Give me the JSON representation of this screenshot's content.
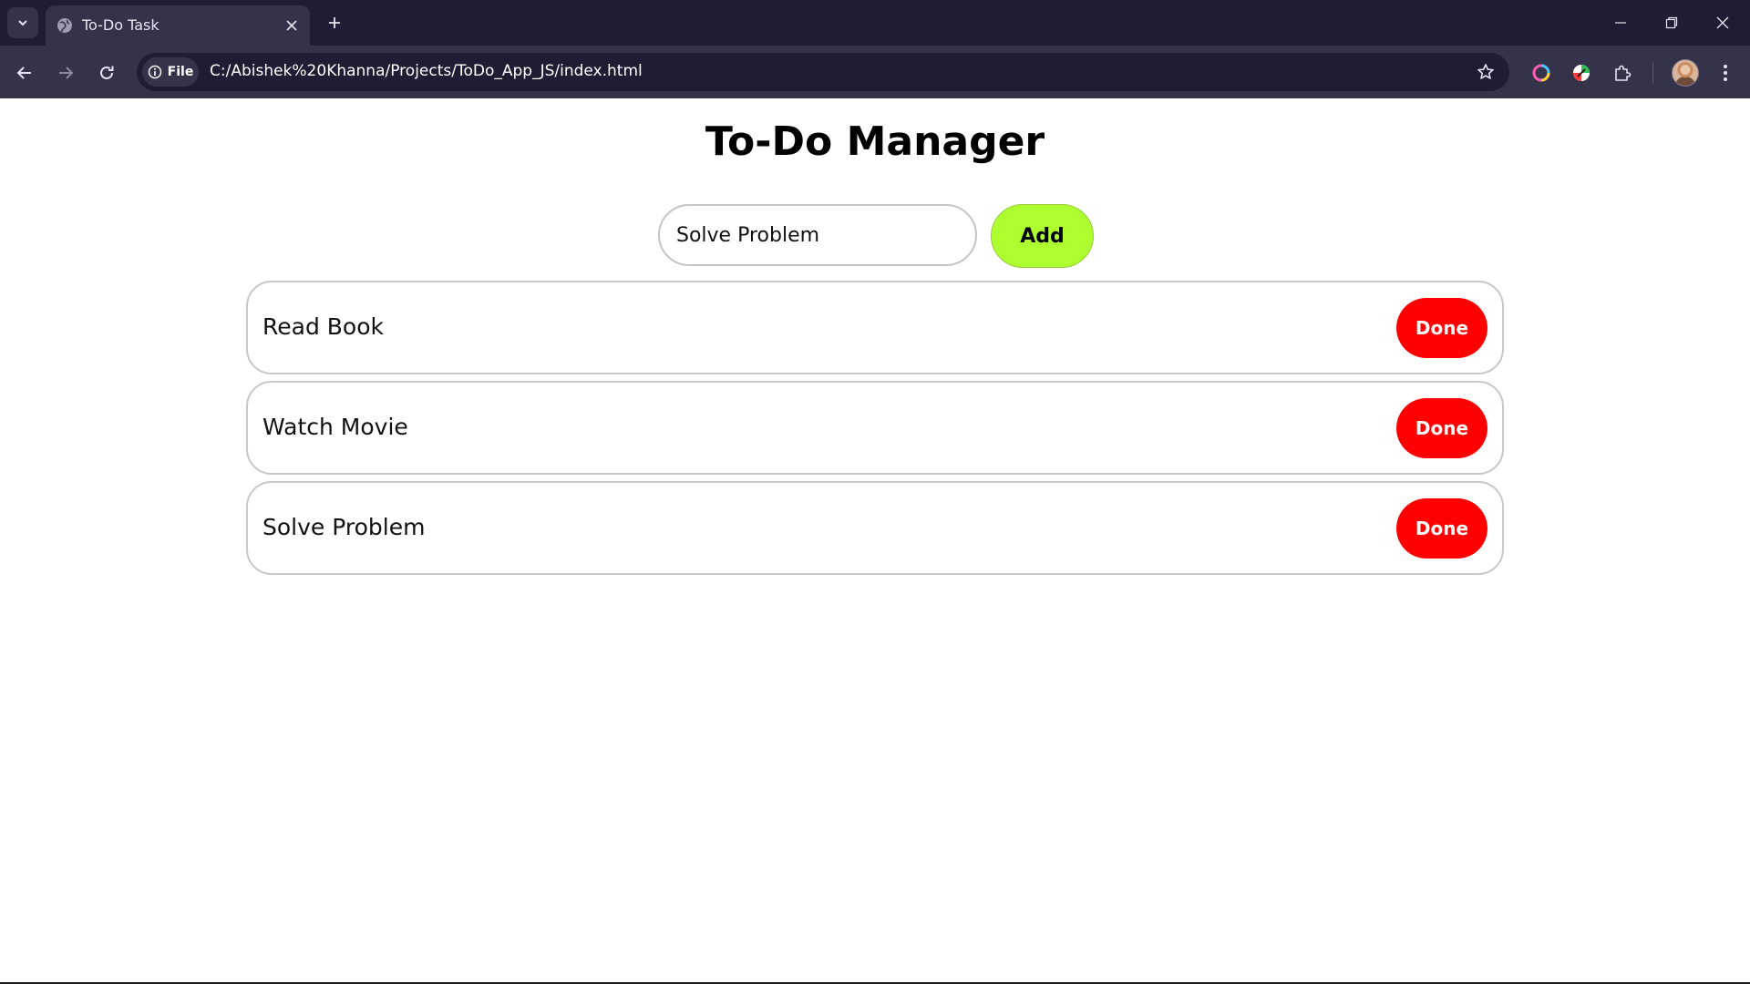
{
  "browser": {
    "tab": {
      "title": "To-Do Task",
      "favicon": "globe-icon"
    },
    "address_bar": {
      "site_info_label": "File",
      "url": "C:/Abishek%20Khanna/Projects/ToDo_App_JS/index.html"
    },
    "colors": {
      "tabbar": "#1f1d33",
      "toolbar": "#35334a",
      "omnibox": "#1f1d33"
    }
  },
  "app": {
    "title": "To-Do Manager",
    "input": {
      "value": "Solve Problem"
    },
    "add_button_label": "Add",
    "tasks": [
      {
        "text": "Read Book",
        "button_label": "Done"
      },
      {
        "text": "Watch Movie",
        "button_label": "Done"
      },
      {
        "text": "Solve Problem",
        "button_label": "Done"
      }
    ],
    "colors": {
      "add_button": "#adff2f",
      "done_button": "#ff0000",
      "border": "#c8c8c8"
    }
  }
}
